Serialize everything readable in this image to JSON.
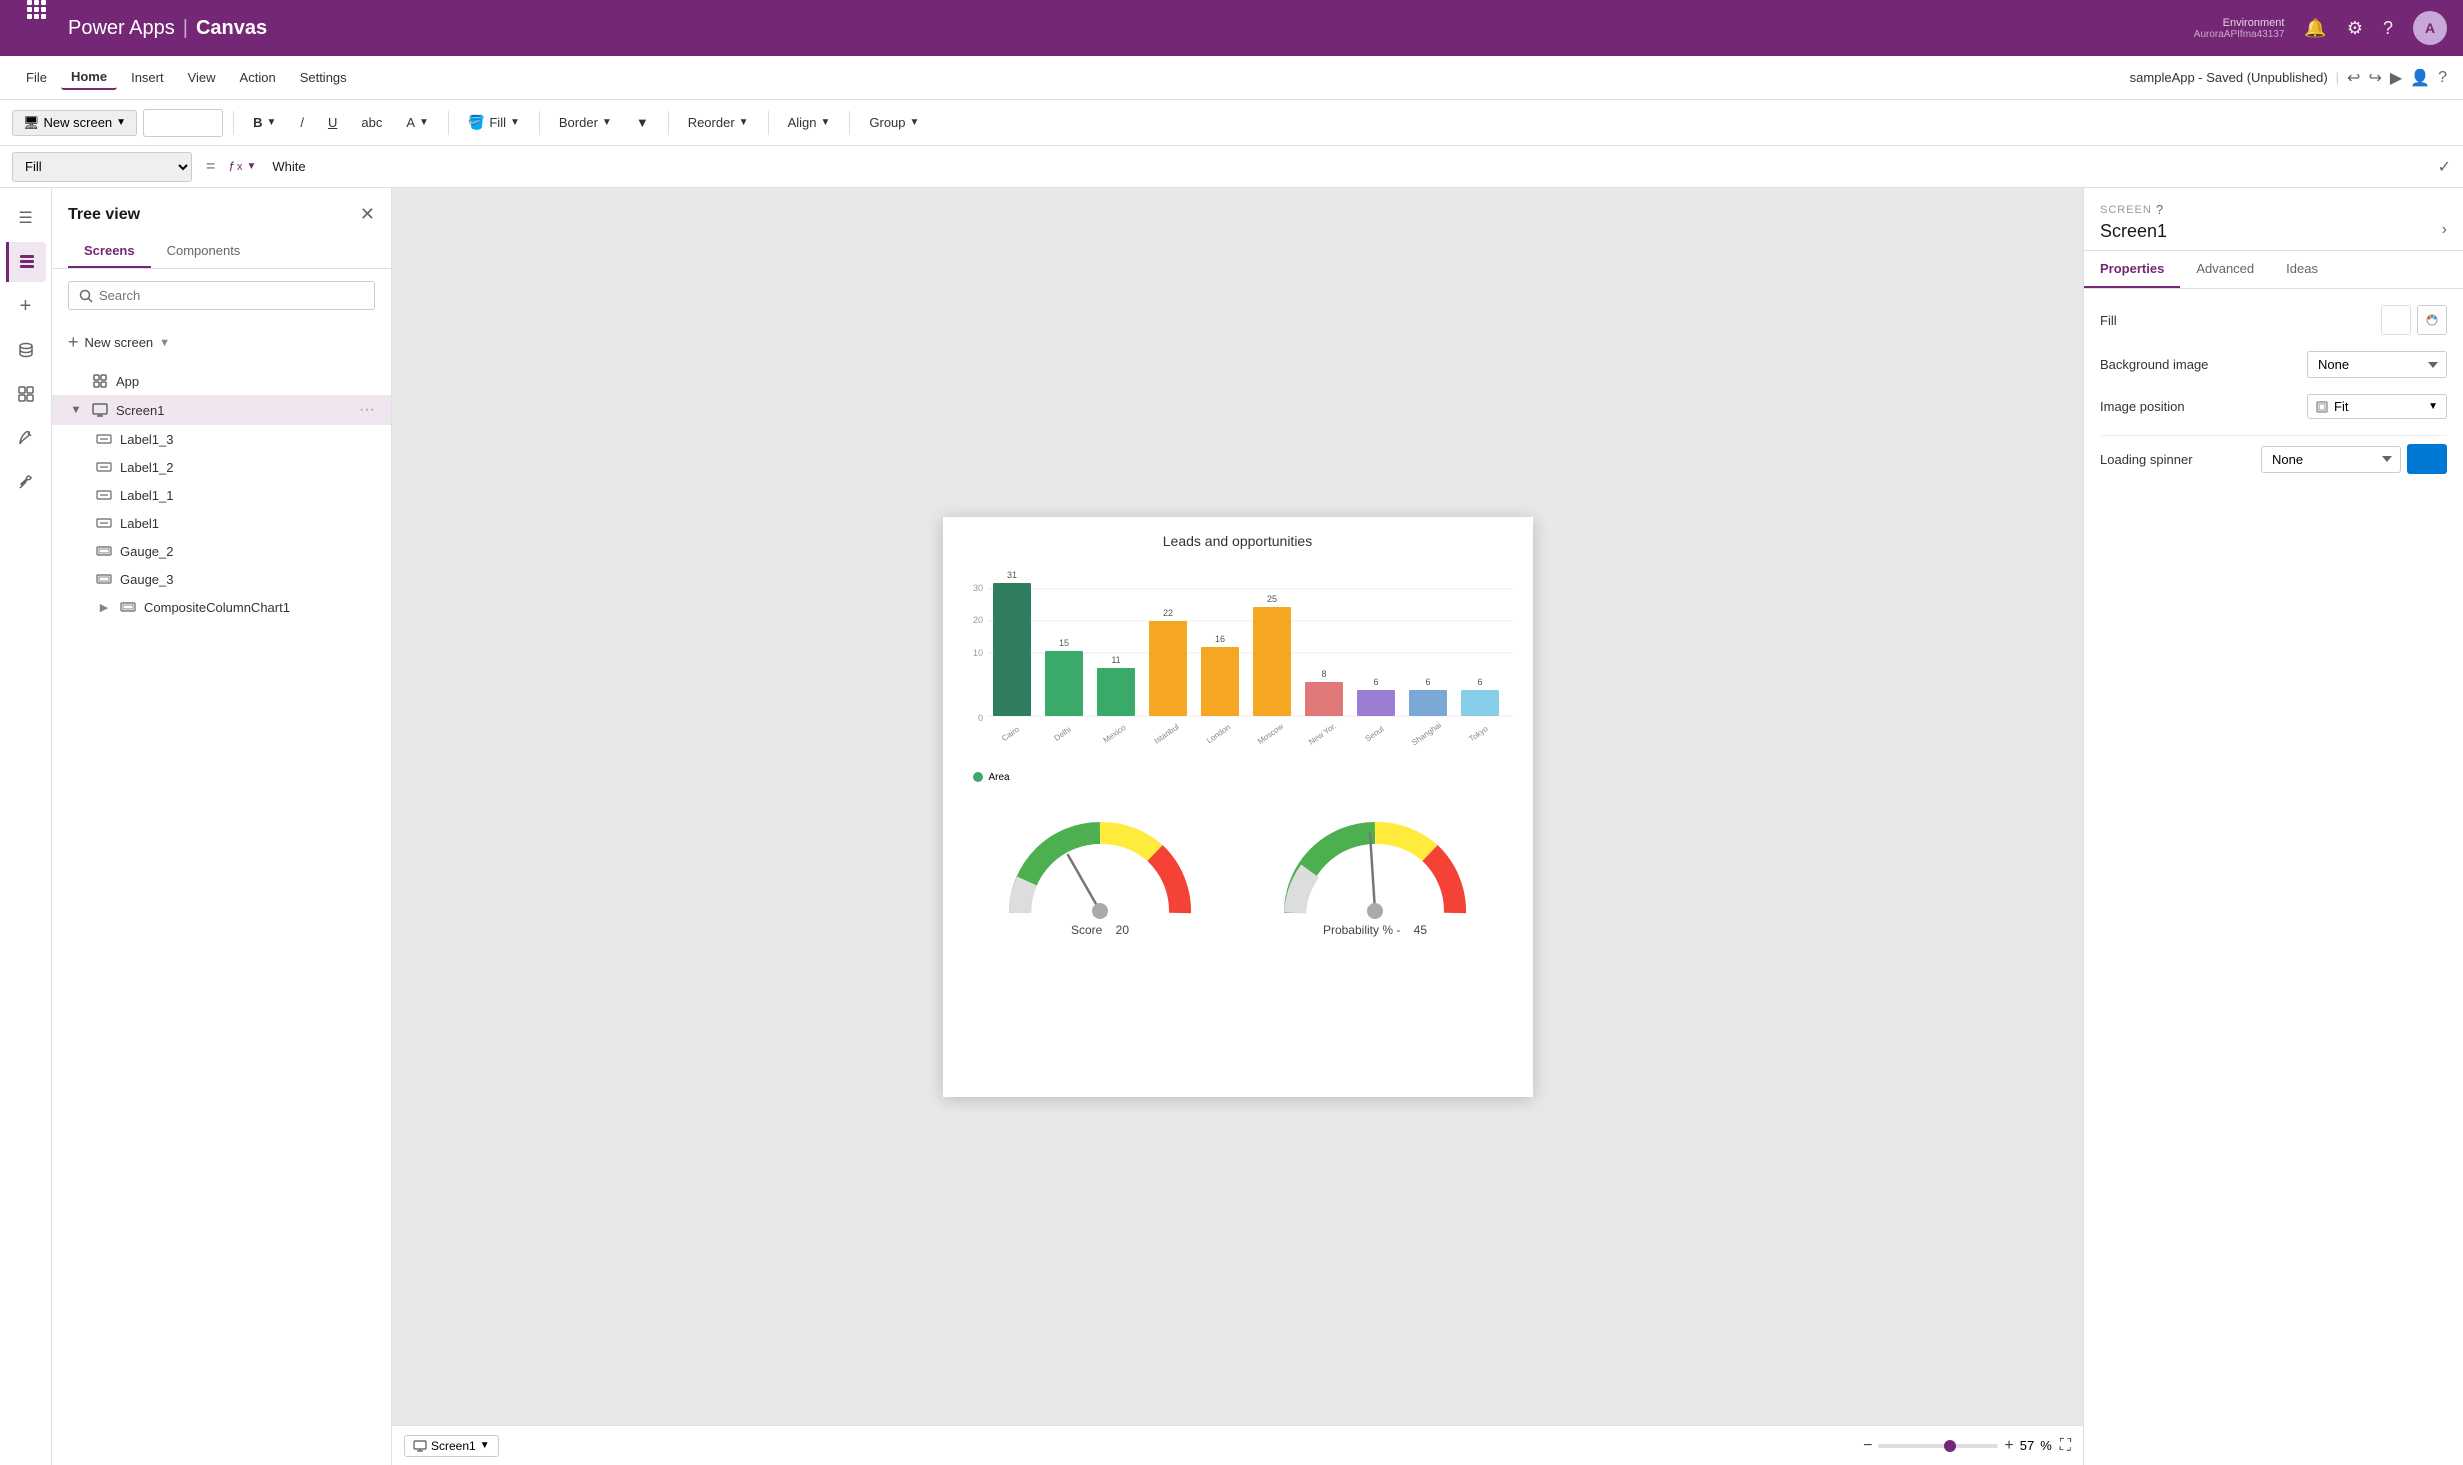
{
  "app": {
    "title": "Power Apps",
    "separator": "|",
    "subtitle": "Canvas"
  },
  "environment": {
    "label": "Environment",
    "value": "AuroraAPIfma43137"
  },
  "header": {
    "saved_text": "sampleApp - Saved (Unpublished)"
  },
  "menu": {
    "items": [
      "File",
      "Home",
      "Insert",
      "View",
      "Action",
      "Settings"
    ],
    "active": "Home"
  },
  "toolbar": {
    "new_screen": "New screen",
    "bold": "B",
    "italic": "/",
    "underline": "U",
    "strikethrough": "abc",
    "font_color": "A",
    "fill": "Fill",
    "border": "Border",
    "reorder": "Reorder",
    "align": "Align",
    "group": "Group"
  },
  "formula_bar": {
    "property": "Fill",
    "value": "White"
  },
  "tree_view": {
    "title": "Tree view",
    "tabs": [
      "Screens",
      "Components"
    ],
    "active_tab": "Screens",
    "search_placeholder": "Search",
    "new_screen": "New screen",
    "items": [
      {
        "label": "App",
        "type": "app",
        "level": 0
      },
      {
        "label": "Screen1",
        "type": "screen",
        "level": 0,
        "selected": true,
        "expanded": true
      },
      {
        "label": "Label1_3",
        "type": "label",
        "level": 1
      },
      {
        "label": "Label1_2",
        "type": "label",
        "level": 1
      },
      {
        "label": "Label1_1",
        "type": "label",
        "level": 1
      },
      {
        "label": "Label1",
        "type": "label",
        "level": 1
      },
      {
        "label": "Gauge_2",
        "type": "gauge",
        "level": 1
      },
      {
        "label": "Gauge_3",
        "type": "gauge",
        "level": 1
      },
      {
        "label": "CompositeColumnChart1",
        "type": "chart",
        "level": 1
      }
    ]
  },
  "canvas": {
    "screen_name": "Screen1",
    "zoom": "57",
    "zoom_unit": "%"
  },
  "chart": {
    "title": "Leads and opportunities",
    "bars": [
      {
        "value": 31,
        "color": "#2e8b57",
        "label": "Cairo"
      },
      {
        "value": 15,
        "color": "#3aaa6a",
        "label": "Delhi"
      },
      {
        "value": 11,
        "color": "#3aaa6a",
        "label": "Mexico..."
      },
      {
        "value": 22,
        "color": "#f4a460",
        "label": "Istanbul"
      },
      {
        "value": 16,
        "color": "#f4a460",
        "label": "London"
      },
      {
        "value": 25,
        "color": "#f4a460",
        "label": "Moscow"
      },
      {
        "value": 8,
        "color": "#cd7f7f",
        "label": "New Yor..."
      },
      {
        "value": 6,
        "color": "#9370db",
        "label": "Seoul"
      },
      {
        "value": 6,
        "color": "#6495ed",
        "label": "Shanghai"
      },
      {
        "value": 6,
        "color": "#87ceeb",
        "label": "Tokyo"
      }
    ],
    "legend": "Area"
  },
  "gauges": [
    {
      "label": "Score",
      "value": "20",
      "needle_angle": -30
    },
    {
      "label": "Probability % -",
      "value": "45",
      "needle_angle": 10
    }
  ],
  "properties": {
    "section_label": "SCREEN",
    "title": "Screen1",
    "tabs": [
      "Properties",
      "Advanced",
      "Ideas"
    ],
    "active_tab": "Properties",
    "fill_label": "Fill",
    "background_image_label": "Background image",
    "background_image_value": "None",
    "image_position_label": "Image position",
    "image_position_value": "Fit",
    "loading_spinner_label": "Loading spinner",
    "loading_spinner_value": "None",
    "advanced_label": "Advanced",
    "ideas_label": "Ideas"
  }
}
